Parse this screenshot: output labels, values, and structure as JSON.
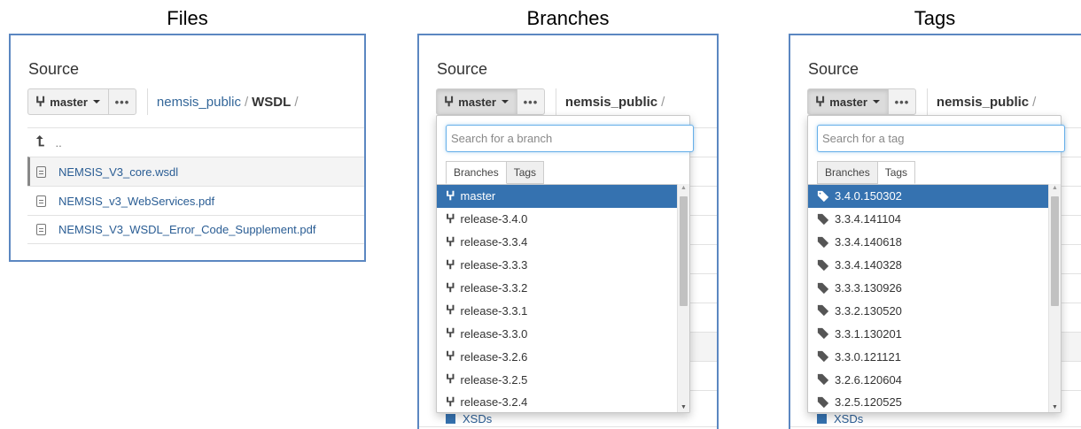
{
  "titles": {
    "files": "Files",
    "branches": "Branches",
    "tags": "Tags"
  },
  "common": {
    "source_heading": "Source",
    "branch_button": "master",
    "more_button": "•••",
    "repo": "nemsis_public",
    "slash": "/"
  },
  "files_panel": {
    "current_folder": "WSDL",
    "up_label": "..",
    "files": [
      {
        "name": "NEMSIS_V3_core.wsdl",
        "selected": true
      },
      {
        "name": "NEMSIS_v3_WebServices.pdf",
        "selected": false
      },
      {
        "name": "NEMSIS_V3_WSDL_Error_Code_Supplement.pdf",
        "selected": false
      }
    ]
  },
  "branches_panel": {
    "search_placeholder": "Search for a branch",
    "tab_branches": "Branches",
    "tab_tags": "Tags",
    "active_tab": "Branches",
    "items": [
      "master",
      "release-3.4.0",
      "release-3.3.4",
      "release-3.3.3",
      "release-3.3.2",
      "release-3.3.1",
      "release-3.3.0",
      "release-3.2.6",
      "release-3.2.5",
      "release-3.2.4"
    ],
    "selected": "master",
    "underlying_item": "XSDs"
  },
  "tags_panel": {
    "search_placeholder": "Search for a tag",
    "tab_branches": "Branches",
    "tab_tags": "Tags",
    "active_tab": "Tags",
    "items": [
      "3.4.0.150302",
      "3.3.4.141104",
      "3.3.4.140618",
      "3.3.4.140328",
      "3.3.3.130926",
      "3.3.2.130520",
      "3.3.1.130201",
      "3.3.0.121121",
      "3.2.6.120604",
      "3.2.5.120525"
    ],
    "selected": "3.4.0.150302",
    "underlying_item": "XSDs"
  },
  "colors": {
    "panel_border": "#5b87c1",
    "selected_item": "#3572b0",
    "link": "#336699"
  },
  "icons": {
    "branch": "branch-icon",
    "tag": "tag-icon",
    "file": "file-icon",
    "up": "up-arrow-icon"
  }
}
